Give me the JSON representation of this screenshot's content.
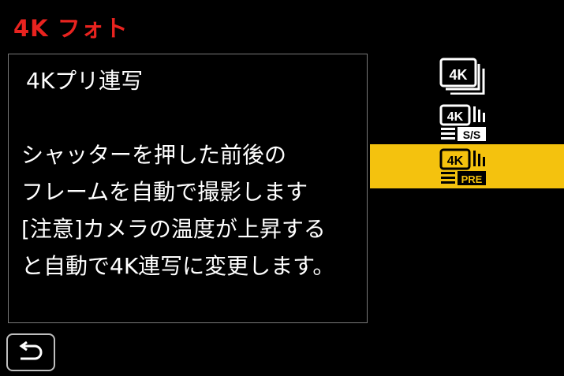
{
  "header": {
    "title": "4K フォト"
  },
  "description": {
    "mode_name": "4Kプリ連写",
    "lines": [
      "シャッターを押した前後の",
      "フレームを自動で撮影します",
      "[注意]カメラの温度が上昇する",
      "と自動で4K連写に変更します。"
    ]
  },
  "modes": {
    "items": [
      {
        "icon": "4k-burst-icon",
        "badge": "",
        "selected": false
      },
      {
        "icon": "4k-burst-start-stop-icon",
        "badge": "S/S",
        "selected": false
      },
      {
        "icon": "4k-pre-burst-icon",
        "badge": "PRE",
        "selected": true
      }
    ]
  },
  "colors": {
    "title": "#e8231f",
    "selected_background": "#f4c20e",
    "background": "#000000",
    "text": "#ffffff"
  },
  "footer": {
    "back_icon": "return-icon"
  }
}
